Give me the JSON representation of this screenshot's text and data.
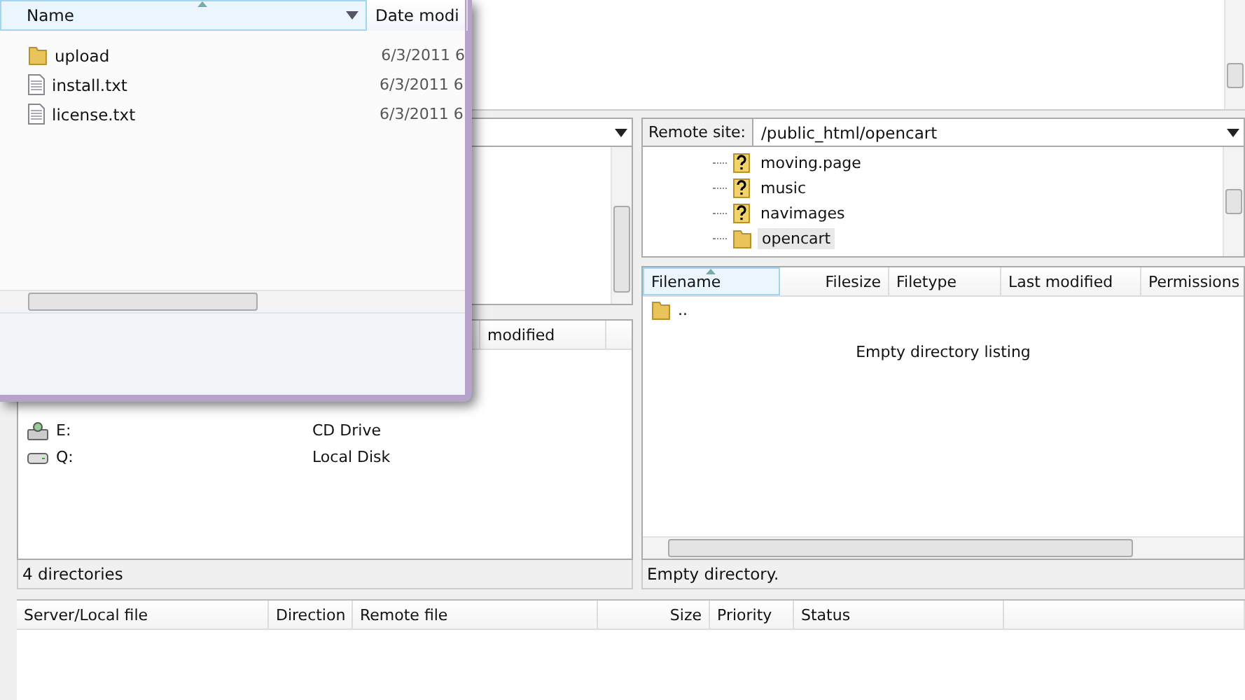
{
  "explorer": {
    "columns": [
      {
        "label": "Name",
        "sorted": true
      },
      {
        "label": "Date modi",
        "sorted": false
      }
    ],
    "rows": [
      {
        "kind": "folder",
        "name": "upload",
        "date": "6/3/2011 6"
      },
      {
        "kind": "file",
        "name": "install.txt",
        "date": "6/3/2011 6"
      },
      {
        "kind": "file",
        "name": "license.txt",
        "date": "6/3/2011 6"
      }
    ]
  },
  "local": {
    "header_columns": [
      "modified"
    ],
    "drives": [
      {
        "kind": "cd",
        "name": "E:",
        "type": "CD Drive"
      },
      {
        "kind": "disk",
        "name": "Q:",
        "type": "Local Disk"
      }
    ],
    "status": "4 directories"
  },
  "remote": {
    "label": "Remote site:",
    "path": "/public_html/opencart",
    "tree": [
      {
        "kind": "unknown",
        "name": "moving.page",
        "selected": false
      },
      {
        "kind": "unknown",
        "name": "music",
        "selected": false
      },
      {
        "kind": "unknown",
        "name": "navimages",
        "selected": false
      },
      {
        "kind": "folder",
        "name": "opencart",
        "selected": true
      }
    ],
    "columns": [
      {
        "label": "Filename",
        "sorted": true
      },
      {
        "label": "Filesize",
        "sorted": false
      },
      {
        "label": "Filetype",
        "sorted": false
      },
      {
        "label": "Last modified",
        "sorted": false
      },
      {
        "label": "Permissions",
        "sorted": false
      }
    ],
    "rows": [
      {
        "kind": "folder",
        "name": ".."
      }
    ],
    "empty_message": "Empty directory listing",
    "status": "Empty directory."
  },
  "queue": {
    "columns": [
      "Server/Local file",
      "Direction",
      "Remote file",
      "Size",
      "Priority",
      "Status"
    ]
  }
}
